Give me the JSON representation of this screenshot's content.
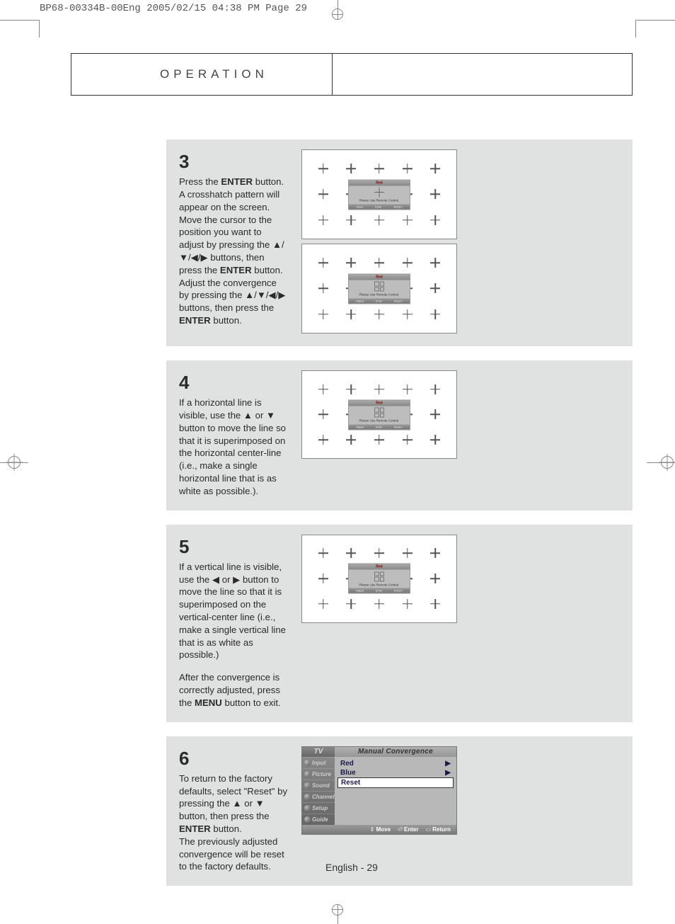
{
  "imposition": "BP68-00334B-00Eng  2005/02/15  04:38 PM  Page 29",
  "header": {
    "title": "OPERATION"
  },
  "osd": {
    "title": "Red",
    "msg": "Please Use Remote Control.",
    "bar": {
      "adjust": "Adjust",
      "move": "Move",
      "enter": "Enter",
      "return": "Return"
    }
  },
  "steps": {
    "s3": {
      "num": "3",
      "p1a": "Press the ",
      "b1": "ENTER",
      "p1b": " button. A crosshatch pattern will appear on the screen. Move the cursor to the position you want to adjust by pressing the ",
      "arrows1": "▲/▼/◀/▶",
      "p1c": " buttons, then press the ",
      "b2": "ENTER",
      "p1d": " button.",
      "p2a": "Adjust the convergence by pressing the ",
      "arrows2": "▲/▼/◀/▶",
      "p2b": " buttons, then press the ",
      "b3": "ENTER",
      "p2c": " button."
    },
    "s4": {
      "num": "4",
      "p1a": "If a horizontal line is visible, use the ",
      "ar1": "▲",
      "or1": " or ",
      "ar2": "▼",
      "p1b": " button to move the line so that it is superimposed on the horizontal center-line (i.e., make a single horizontal line that is as white as possible.)."
    },
    "s5": {
      "num": "5",
      "p1a": "If a vertical line is visible, use the ",
      "ar1": "◀",
      "or1": " or ",
      "ar2": "▶",
      "p1b": " button to move the line so that it is superimposed on the vertical-center line (i.e., make a single vertical line that is as white as possible.)",
      "p2a": "After the convergence is correctly adjusted, press the ",
      "b1": "MENU",
      "p2b": " button to exit."
    },
    "s6": {
      "num": "6",
      "p1a": "To return to the factory defaults, select \"Reset\" by pressing the ",
      "ar1": "▲",
      "or1": " or ",
      "ar2": "▼",
      "p1b": " button, then press the ",
      "b1": "ENTER",
      "p1c": " button.",
      "p2": "The previously adjusted convergence will be reset to the factory defaults."
    }
  },
  "menu": {
    "tv": "TV",
    "title": "Manual Convergence",
    "side": [
      "Input",
      "Picture",
      "Sound",
      "Channel",
      "Setup",
      "Guide"
    ],
    "rows": [
      {
        "label": "Red",
        "arrow": "▶"
      },
      {
        "label": "Blue",
        "arrow": "▶"
      },
      {
        "label": "Reset",
        "arrow": ""
      }
    ],
    "bottom": {
      "move": "Move",
      "enter": "Enter",
      "return": "Return"
    }
  },
  "footer": "English - 29"
}
